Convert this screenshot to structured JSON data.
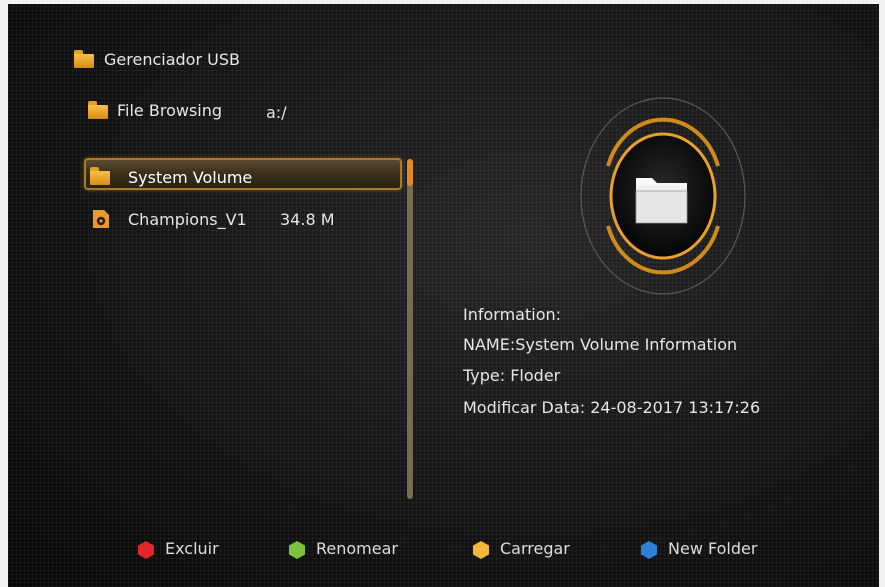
{
  "header": {
    "title": "Gerenciador USB"
  },
  "browser": {
    "label": "File Browsing",
    "path": "a:/"
  },
  "files": [
    {
      "name": "System Volume",
      "size": "",
      "icon": "folder-icon",
      "selected": true
    },
    {
      "name": "Champions_V1",
      "size": "34.8 M",
      "icon": "media-file-icon",
      "selected": false
    }
  ],
  "info": {
    "heading": "Information:",
    "name_line": "NAME:System Volume Information",
    "type_line": "Type: Floder",
    "date_line": "Modificar Data: 24-08-2017 13:17:26"
  },
  "buttons": [
    {
      "label": "Excluir",
      "color": "#e0282c"
    },
    {
      "label": "Renomear",
      "color": "#7cc23a"
    },
    {
      "label": "Carregar",
      "color": "#f0b93a"
    },
    {
      "label": "New Folder",
      "color": "#2e7fd6"
    }
  ],
  "colors": {
    "accent": "#d99a2b",
    "selection_border": "#a77a2c"
  }
}
